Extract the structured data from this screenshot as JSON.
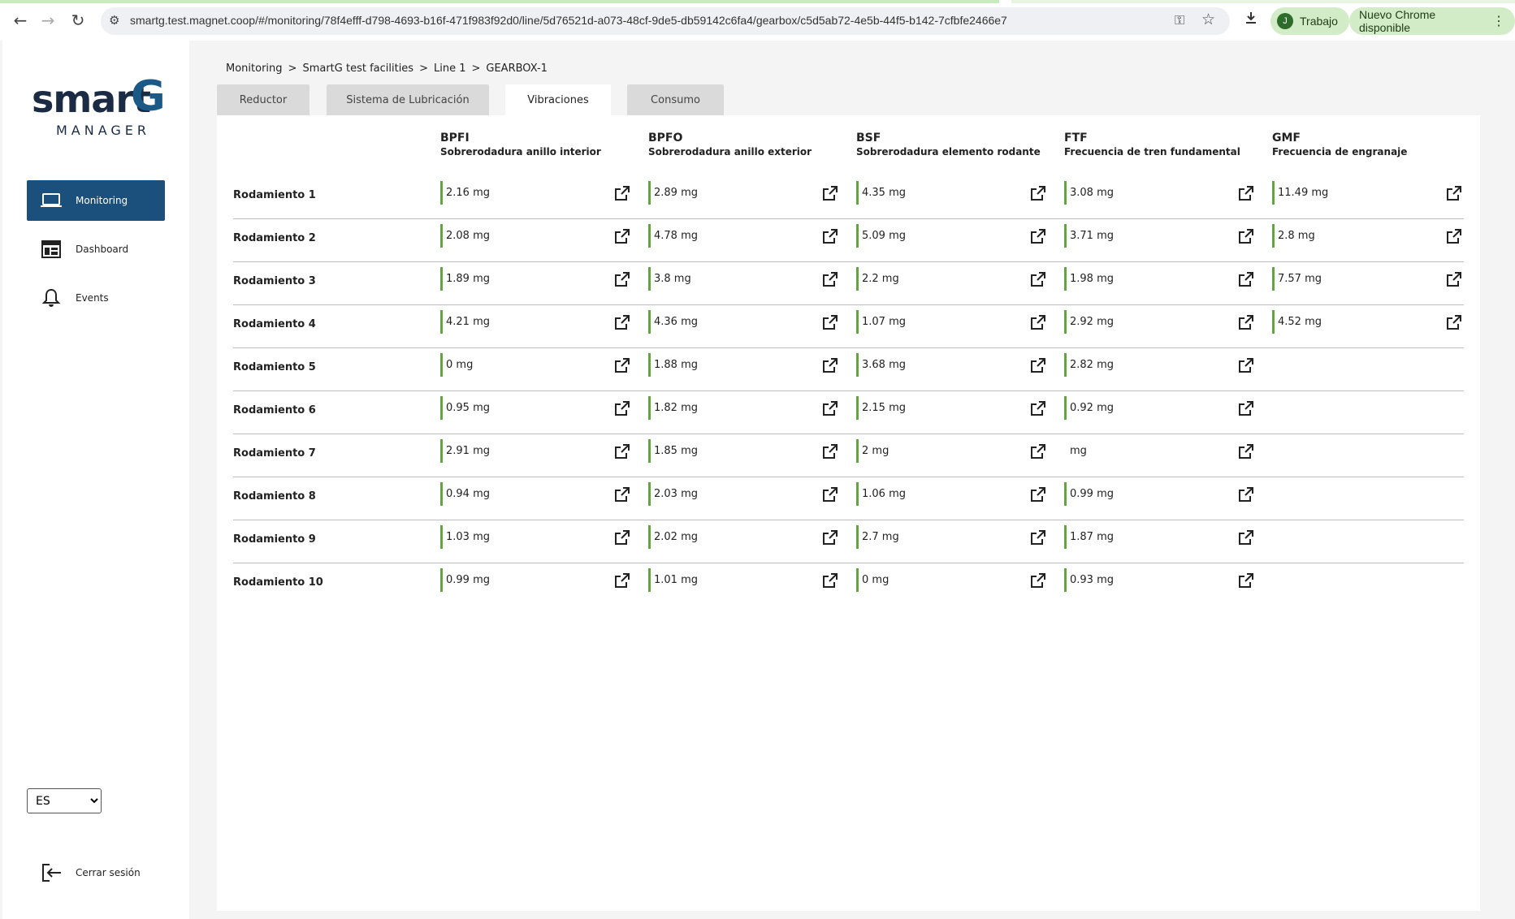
{
  "browser": {
    "url": "smartg.test.magnet.coop/#/monitoring/78f4efff-d798-4693-b16f-471f983f92d0/line/5d76521d-a073-48cf-9de5-db59142c6fa4/gearbox/c5d5ab72-4e5b-44f5-b142-7cfbfe2466e7",
    "profile_initial": "J",
    "profile_label": "Trabajo",
    "update_label": "Nuevo Chrome disponible"
  },
  "logo": {
    "word": "smart",
    "letter": "G",
    "sub": "MANAGER"
  },
  "sidebar": {
    "items": [
      {
        "label": "Monitoring",
        "icon": "laptop-icon",
        "active": true
      },
      {
        "label": "Dashboard",
        "icon": "dashboard-icon",
        "active": false
      },
      {
        "label": "Events",
        "icon": "bell-icon",
        "active": false
      }
    ],
    "language": "ES",
    "logout_label": "Cerrar sesión"
  },
  "breadcrumb": [
    "Monitoring",
    ">",
    "SmartG test facilities",
    ">",
    "Line 1",
    ">",
    "GEARBOX-1"
  ],
  "tabs": [
    {
      "label": "Reductor",
      "active": false
    },
    {
      "label": "Sistema de Lubricación",
      "active": false
    },
    {
      "label": "Vibraciones",
      "active": true
    },
    {
      "label": "Consumo",
      "active": false
    }
  ],
  "columns": [
    {
      "code": "BPFI",
      "desc": "Sobrerodadura anillo interior"
    },
    {
      "code": "BPFO",
      "desc": "Sobrerodadura anillo exterior"
    },
    {
      "code": "BSF",
      "desc": "Sobrerodadura elemento rodante"
    },
    {
      "code": "FTF",
      "desc": "Frecuencia de tren fundamental"
    },
    {
      "code": "GMF",
      "desc": "Frecuencia de engranaje"
    }
  ],
  "rows": [
    {
      "name": "Rodamiento 1",
      "values": [
        "2.16 mg",
        "2.89 mg",
        "4.35 mg",
        "3.08 mg",
        "11.49 mg"
      ]
    },
    {
      "name": "Rodamiento 2",
      "values": [
        "2.08 mg",
        "4.78 mg",
        "5.09 mg",
        "3.71 mg",
        "2.8 mg"
      ]
    },
    {
      "name": "Rodamiento 3",
      "values": [
        "1.89 mg",
        "3.8 mg",
        "2.2 mg",
        "1.98 mg",
        "7.57 mg"
      ]
    },
    {
      "name": "Rodamiento 4",
      "values": [
        "4.21 mg",
        "4.36 mg",
        "1.07 mg",
        "2.92 mg",
        "4.52 mg"
      ]
    },
    {
      "name": "Rodamiento 5",
      "values": [
        "0 mg",
        "1.88 mg",
        "3.68 mg",
        "2.82 mg",
        null
      ]
    },
    {
      "name": "Rodamiento 6",
      "values": [
        "0.95 mg",
        "1.82 mg",
        "2.15 mg",
        "0.92 mg",
        null
      ]
    },
    {
      "name": "Rodamiento 7",
      "values": [
        "2.91 mg",
        "1.85 mg",
        "2 mg",
        " mg",
        null
      ]
    },
    {
      "name": "Rodamiento 8",
      "values": [
        "0.94 mg",
        "2.03 mg",
        "1.06 mg",
        "0.99 mg",
        null
      ]
    },
    {
      "name": "Rodamiento 9",
      "values": [
        "1.03 mg",
        "2.02 mg",
        "2.7 mg",
        "1.87 mg",
        null
      ]
    },
    {
      "name": "Rodamiento 10",
      "values": [
        "0.99 mg",
        "1.01 mg",
        "0 mg",
        "0.93 mg",
        null
      ]
    }
  ],
  "colors": {
    "accent": "#1b4f7c",
    "value_bar": "#5fa83c",
    "value_bar_empty": "#ffffff"
  }
}
